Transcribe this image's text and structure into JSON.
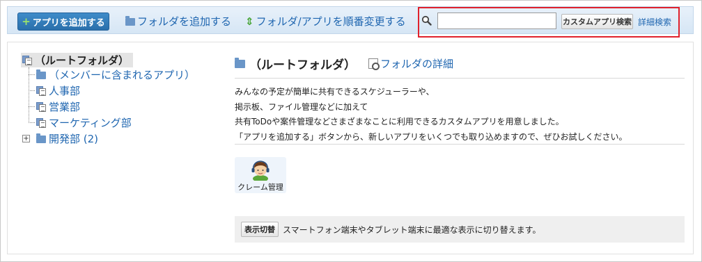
{
  "toolbar": {
    "add_app_label": "アプリを追加する",
    "add_folder_label": "フォルダを追加する",
    "reorder_label": "フォルダ/アプリを順番変更する",
    "search_value": "",
    "search_button_label": "カスタムアプリ検索",
    "detail_search_label": "詳細検索"
  },
  "tree": {
    "root_label": "（ルートフォルダ）",
    "items": [
      {
        "label": "（メンバーに含まれるアプリ）",
        "icon": "folder-icon"
      },
      {
        "label": "人事部",
        "icon": "app-list-icon"
      },
      {
        "label": "営業部",
        "icon": "app-list-icon"
      },
      {
        "label": "マーケティング部",
        "icon": "app-list-icon"
      },
      {
        "label": "開発部 (2)",
        "icon": "folder-icon",
        "expander": "+"
      }
    ]
  },
  "content": {
    "title": "（ルートフォルダ）",
    "folder_detail_label": "フォルダの詳細",
    "description": [
      "みんなの予定が簡単に共有できるスケジューラーや、",
      "掲示板、ファイル管理などに加えて",
      "共有ToDoや案件管理などさまざまなことに利用できるカスタムアプリを用意しました。",
      "「アプリを追加する」ボタンから、新しいアプリをいくつでも取り込めますので、ぜひお試しください。"
    ],
    "apps": [
      {
        "label": "クレーム管理",
        "icon": "support-operator-icon"
      }
    ],
    "switch_button_label": "表示切替",
    "switch_text": "スマートフォン端末やタブレット端末に最適な表示に切り替えます。"
  },
  "colors": {
    "link": "#1f66b0",
    "primary_button": "#2a6fab",
    "toolbar_bg": "#d6e6f5",
    "highlight_border": "#e0212c"
  }
}
